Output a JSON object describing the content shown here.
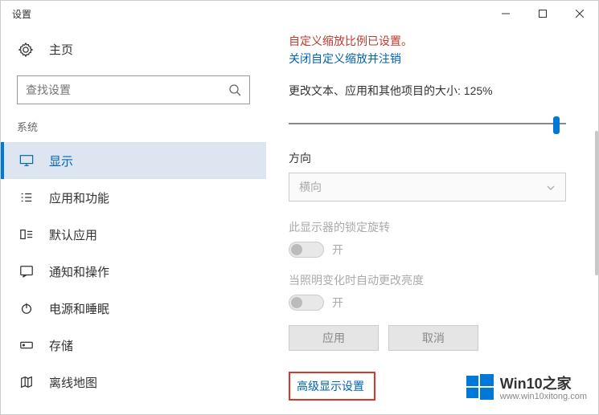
{
  "window": {
    "title": "设置"
  },
  "home": {
    "label": "主页"
  },
  "search": {
    "placeholder": "查找设置"
  },
  "section": {
    "title": "系统"
  },
  "nav": {
    "items": [
      {
        "label": "显示"
      },
      {
        "label": "应用和功能"
      },
      {
        "label": "默认应用"
      },
      {
        "label": "通知和操作"
      },
      {
        "label": "电源和睡眠"
      },
      {
        "label": "存储"
      },
      {
        "label": "离线地图"
      }
    ]
  },
  "content": {
    "warning": "自定义缩放比例已设置。",
    "disable_link": "关闭自定义缩放并注销",
    "scale_label": "更改文本、应用和其他项目的大小: 125%",
    "orientation_label": "方向",
    "orientation_value": "横向",
    "lock_rotation_label": "此显示器的锁定旋转",
    "lock_rotation_state": "开",
    "brightness_auto_label": "当照明变化时自动更改亮度",
    "brightness_auto_state": "开",
    "apply_btn": "应用",
    "cancel_btn": "取消",
    "advanced_link": "高级显示设置"
  },
  "watermark": {
    "brand": "Win10之家",
    "url": "www.win10xitong.com"
  }
}
